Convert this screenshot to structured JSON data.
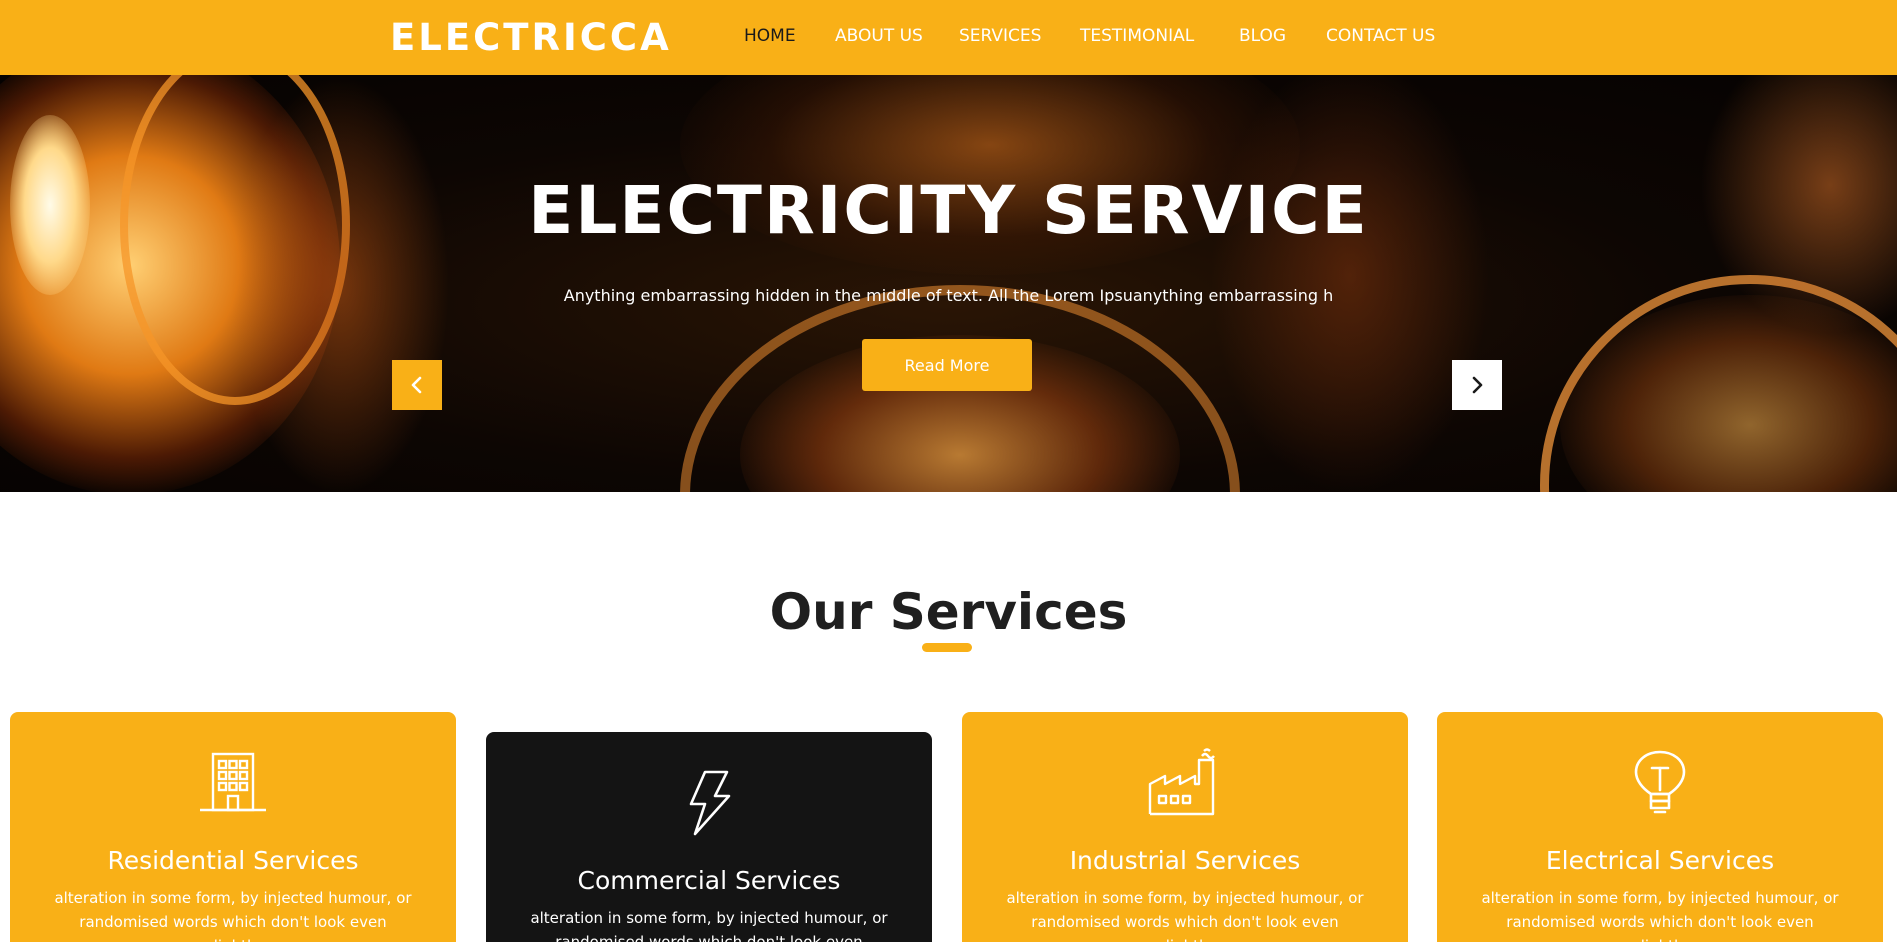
{
  "brand": {
    "logo": "ELECTRICCA",
    "accent": "#f9b017",
    "dark": "#141414"
  },
  "nav": {
    "items": [
      {
        "label": "HOME",
        "active": true
      },
      {
        "label": "ABOUT US"
      },
      {
        "label": "SERVICES"
      },
      {
        "label": "TESTIMONIAL"
      },
      {
        "label": "BLOG"
      },
      {
        "label": "CONTACT US"
      }
    ]
  },
  "hero": {
    "title": "ELECTRICITY SERVICE",
    "text": "Anything embarrassing hidden in the middle of text. All the Lorem Ipsuanything embarrassing h",
    "button": "Read More",
    "prev_icon": "chevron-left-icon",
    "next_icon": "chevron-right-icon"
  },
  "services": {
    "title": "Our Services",
    "cards": [
      {
        "title": "Residential Services",
        "text": "alteration in some form, by injected humour, or randomised words which don't look even slightly",
        "icon": "building-icon"
      },
      {
        "title": "Commercial Services",
        "text": "alteration in some form, by injected humour, or randomised words which don't look even slightly",
        "icon": "lightning-icon"
      },
      {
        "title": "Industrial Services",
        "text": "alteration in some form, by injected humour, or randomised words which don't look even slightly",
        "icon": "factory-icon"
      },
      {
        "title": "Electrical Services",
        "text": "alteration in some form, by injected humour, or randomised words which don't look even slightly",
        "icon": "lightbulb-icon"
      }
    ]
  }
}
